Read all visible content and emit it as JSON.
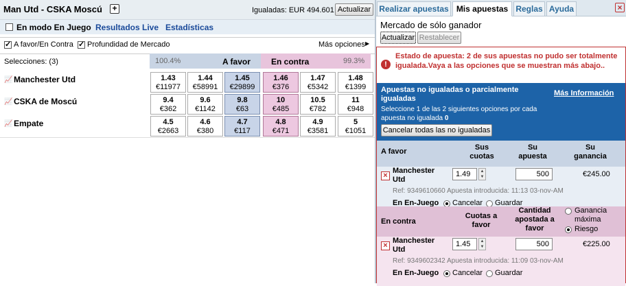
{
  "market": {
    "title": "Man Utd - CSKA Moscú",
    "matched": "Igualadas: EUR 494.601",
    "refresh_label": "Actualizar"
  },
  "links": {
    "inplay": "En modo En Juego",
    "live": "Resultados Live",
    "stats": "Estadísticas"
  },
  "options": {
    "back_lay": "A favor/En Contra",
    "depth": "Profundidad de Mercado",
    "more": "Más opciones"
  },
  "header": {
    "selections": "Selecciones: (3)",
    "back_pct": "100.4%",
    "back": "A favor",
    "lay": "En contra",
    "lay_pct": "99.3%"
  },
  "runners": [
    {
      "name": "Manchester Utd",
      "prices": [
        {
          "o": "1.43",
          "v": "€11977"
        },
        {
          "o": "1.44",
          "v": "€58991"
        },
        {
          "o": "1.45",
          "v": "€29899"
        },
        {
          "o": "1.46",
          "v": "€376"
        },
        {
          "o": "1.47",
          "v": "€5342"
        },
        {
          "o": "1.48",
          "v": "€1399"
        }
      ]
    },
    {
      "name": "CSKA de Moscú",
      "prices": [
        {
          "o": "9.4",
          "v": "€362"
        },
        {
          "o": "9.6",
          "v": "€1142"
        },
        {
          "o": "9.8",
          "v": "€63"
        },
        {
          "o": "10",
          "v": "€485"
        },
        {
          "o": "10.5",
          "v": "€782"
        },
        {
          "o": "11",
          "v": "€948"
        }
      ]
    },
    {
      "name": "Empate",
      "prices": [
        {
          "o": "4.5",
          "v": "€2663"
        },
        {
          "o": "4.6",
          "v": "€380"
        },
        {
          "o": "4.7",
          "v": "€117"
        },
        {
          "o": "4.8",
          "v": "€471"
        },
        {
          "o": "4.9",
          "v": "€3581"
        },
        {
          "o": "5",
          "v": "€1051"
        }
      ]
    }
  ],
  "tabs": [
    "Realizar apuestas",
    "Mis apuestas",
    "Reglas",
    "Ayuda"
  ],
  "right": {
    "market_type": "Mercado de sólo ganador",
    "refresh": "Actualizar",
    "reset": "Restablecer",
    "error": "Estado de apuesta: 2 de sus apuestas no pudo ser totalmente igualada.Vaya a las opciones que se muestran más abajo..",
    "unmatched_title": "Apuestas no igualadas o parcialmente igualadas",
    "more_info": "Más Información",
    "instructions_a": "Seleccione 1 de las 2 siguientes opciones por cada apuesta no igualada",
    "instructions_count": "0",
    "cancel_all": "Cancelar todas las no igualadas"
  },
  "back_section": {
    "label": "A favor",
    "col1": "Sus cuotas",
    "col2": "Su apuesta",
    "col3": "Su ganancia"
  },
  "back_bet": {
    "runner": "Manchester Utd",
    "odds": "1.49",
    "stake": "500",
    "profit": "€245.00",
    "ref": "Ref: 9349610660 Apuesta introducida: 11:13 03-nov-AM",
    "inplay": "En En-Juego",
    "cancel": "Cancelar",
    "keep": "Guardar"
  },
  "lay_section": {
    "label": "En contra",
    "col1": "Cuotas a favor",
    "col2": "Cantidad apostada a favor",
    "opt1": "Ganancia máxima",
    "opt2": "Riesgo"
  },
  "lay_bet": {
    "runner": "Manchester Utd",
    "odds": "1.45",
    "stake": "500",
    "liability": "€225.00",
    "ref": "Ref: 9349602342 Apuesta introducida: 11:09 03-nov-AM",
    "inplay": "En En-Juego",
    "cancel": "Cancelar",
    "keep": "Guardar"
  },
  "colors": {
    "back": "#c8d4e4",
    "lay": "#e8c4dc",
    "error": "#c03030",
    "panel_blue": "#1d63a8"
  }
}
